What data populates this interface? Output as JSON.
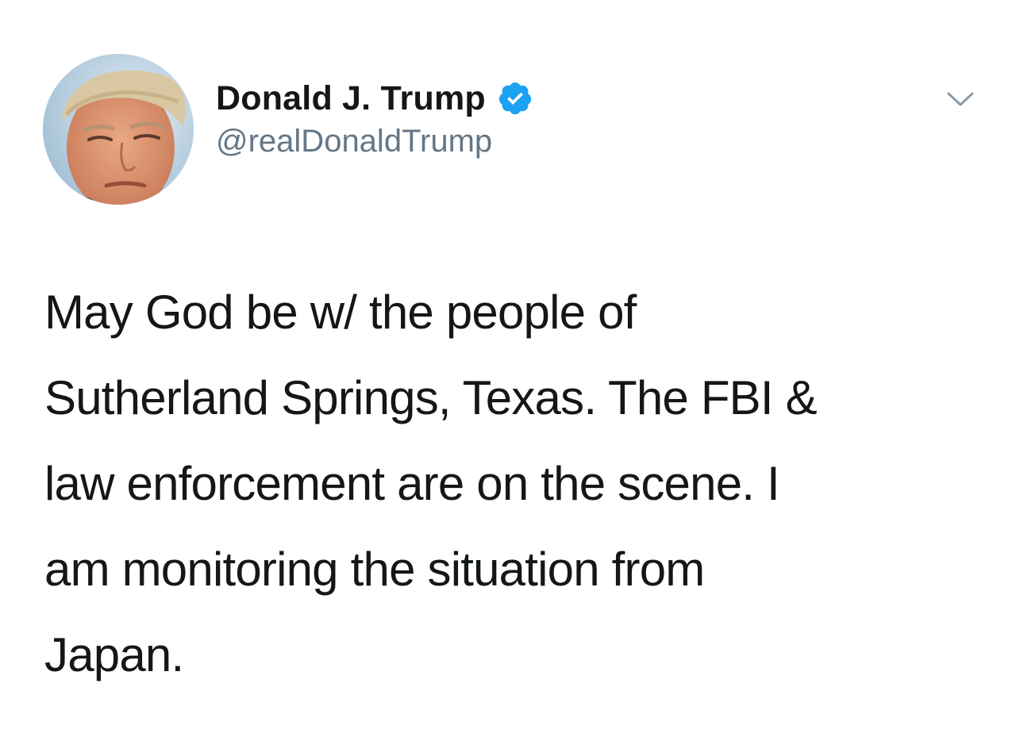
{
  "author": {
    "display_name": "Donald J. Trump",
    "handle": "@realDonaldTrump",
    "verified": true,
    "avatar_icon": "profile-photo",
    "badge_color": "#1da1f2"
  },
  "menu": {
    "icon": "chevron-down-icon"
  },
  "tweet": {
    "lines": [
      "May God be w/ the people of",
      "Sutherland Springs, Texas. The FBI &",
      "law enforcement are on the scene. I",
      "am monitoring the situation from",
      "Japan."
    ]
  },
  "colors": {
    "text": "#14171a",
    "handle": "#657786",
    "background": "#ffffff"
  }
}
